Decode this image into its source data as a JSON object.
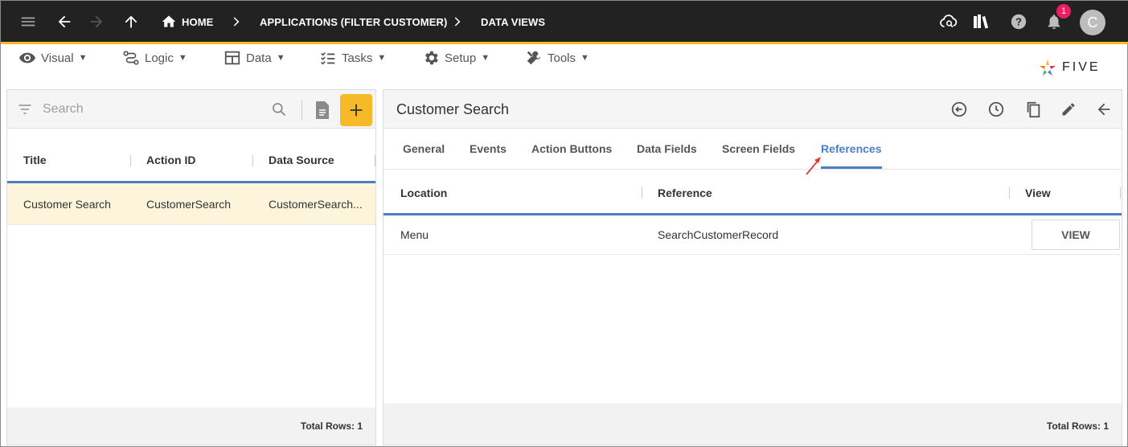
{
  "topbar": {
    "breadcrumb": [
      {
        "label": "HOME"
      },
      {
        "label": "APPLICATIONS (FILTER CUSTOMER)"
      },
      {
        "label": "DATA VIEWS"
      }
    ],
    "notification_count": "1",
    "avatar_letter": "C"
  },
  "menu": [
    {
      "label": "Visual",
      "icon": "eye-icon"
    },
    {
      "label": "Logic",
      "icon": "logic-icon"
    },
    {
      "label": "Data",
      "icon": "table-icon"
    },
    {
      "label": "Tasks",
      "icon": "checklist-icon"
    },
    {
      "label": "Setup",
      "icon": "gear-icon"
    },
    {
      "label": "Tools",
      "icon": "tools-icon"
    }
  ],
  "brand": {
    "name": "FIVE"
  },
  "left": {
    "search_placeholder": "Search",
    "columns": [
      "Title",
      "Action ID",
      "Data Source"
    ],
    "rows": [
      [
        "Customer Search",
        "CustomerSearch",
        "CustomerSearch..."
      ]
    ],
    "total_rows": "Total Rows: 1"
  },
  "right": {
    "title": "Customer Search",
    "tabs": [
      "General",
      "Events",
      "Action Buttons",
      "Data Fields",
      "Screen Fields",
      "References"
    ],
    "active_tab": "References",
    "columns": [
      "Location",
      "Reference",
      "View"
    ],
    "rows": [
      {
        "location": "Menu",
        "reference": "SearchCustomerRecord",
        "action": "VIEW"
      }
    ],
    "total_rows": "Total Rows: 1"
  },
  "colors": {
    "topbar": "#222222",
    "accent": "#f6b928",
    "active_tab": "#4a7fc7",
    "selected_row": "#fdf4dc"
  }
}
